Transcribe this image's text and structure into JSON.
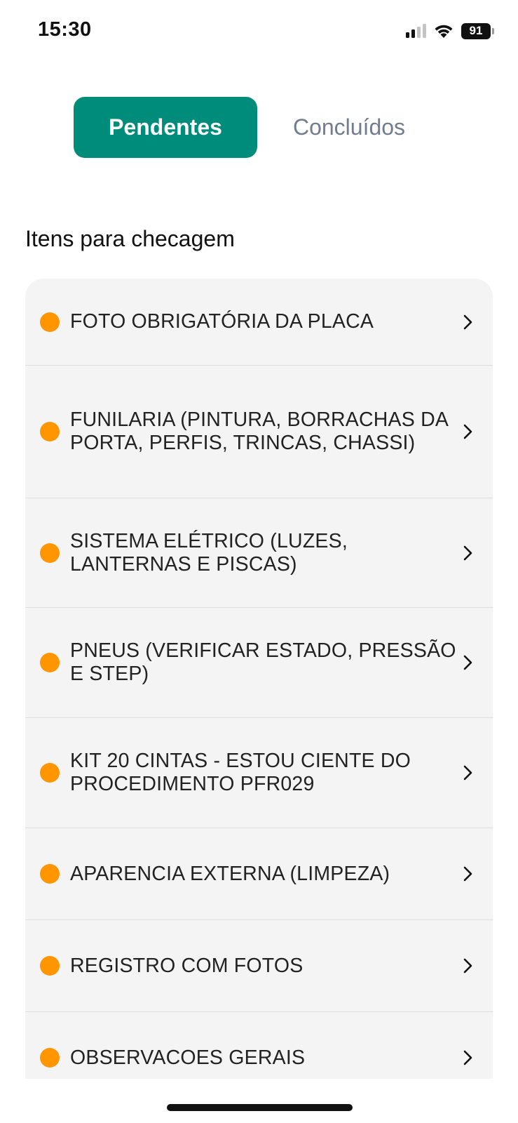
{
  "status_bar": {
    "time": "15:30",
    "battery": "91",
    "icons": [
      "signal-icon",
      "wifi-icon",
      "battery-icon"
    ]
  },
  "tabs": [
    {
      "label": "Pendentes",
      "active": true
    },
    {
      "label": "Concluídos",
      "active": false
    }
  ],
  "section": {
    "title": "Itens para checagem"
  },
  "checklist": {
    "status_color": "#ff9500",
    "items": [
      {
        "label": "FOTO OBRIGATÓRIA DA PLACA"
      },
      {
        "label": "FUNILARIA (PINTURA, BORRACHAS DA PORTA, PERFIS, TRINCAS, CHASSI)"
      },
      {
        "label": "SISTEMA ELÉTRICO (LUZES, LANTERNAS E PISCAS)"
      },
      {
        "label": "PNEUS (VERIFICAR ESTADO, PRESSÃO E STEP)"
      },
      {
        "label": "KIT 20 CINTAS - ESTOU CIENTE DO PROCEDIMENTO PFR029"
      },
      {
        "label": "APARENCIA EXTERNA (LIMPEZA)"
      },
      {
        "label": "REGISTRO COM FOTOS"
      },
      {
        "label": "OBSERVACOES GERAIS"
      }
    ]
  },
  "colors": {
    "accent": "#008c7a",
    "pending_dot": "#ff9500",
    "inactive_tab_text": "#717d8e",
    "list_background": "#f4f4f4"
  }
}
